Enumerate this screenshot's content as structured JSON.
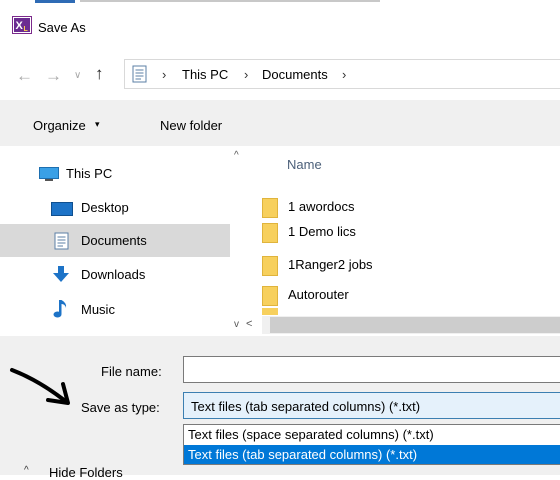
{
  "window": {
    "title": "Save As",
    "icon": "excel-xl-app-icon"
  },
  "address": {
    "back_icon": "arrow-left",
    "forward_icon": "arrow-right",
    "recent_icon": "chevron-down",
    "up_icon": "arrow-up",
    "separator": "›",
    "crumbs": [
      "This PC",
      "Documents"
    ]
  },
  "toolbar": {
    "organize_label": "Organize",
    "organize_caret": "▾",
    "new_folder_label": "New folder"
  },
  "nav_pane": {
    "items": [
      {
        "label": "This PC",
        "icon": "monitor-icon"
      },
      {
        "label": "Desktop",
        "icon": "desktop-icon"
      },
      {
        "label": "Documents",
        "icon": "documents-icon",
        "selected": true
      },
      {
        "label": "Downloads",
        "icon": "download-arrow-icon"
      },
      {
        "label": "Music",
        "icon": "music-note-icon"
      }
    ],
    "scroll_up": "^",
    "scroll_down": "v"
  },
  "file_list": {
    "column_name": "Name",
    "items": [
      {
        "name": "1 awordocs",
        "type": "folder"
      },
      {
        "name": "1 Demo lics",
        "type": "folder"
      },
      {
        "name": "1Ranger2 jobs",
        "type": "folder"
      },
      {
        "name": "Autorouter",
        "type": "folder"
      }
    ],
    "hscroll_left": "<"
  },
  "form": {
    "file_name_label": "File name:",
    "file_name_value": "",
    "save_as_type_label": "Save as type:",
    "save_as_type_value": "Text files (tab separated columns) (*.txt)",
    "options": [
      "Text files (space separated columns) (*.txt)",
      "Text files (tab separated columns) (*.txt)"
    ],
    "selected_option_index": 1
  },
  "footer": {
    "hide_folders_label": "Hide Folders",
    "hide_folders_caret": "^"
  },
  "colors": {
    "accent": "#0078d7",
    "selected_nav": "#d9d9d9",
    "folder": "#f7d05d",
    "panel_bg": "#f0f0f0"
  }
}
